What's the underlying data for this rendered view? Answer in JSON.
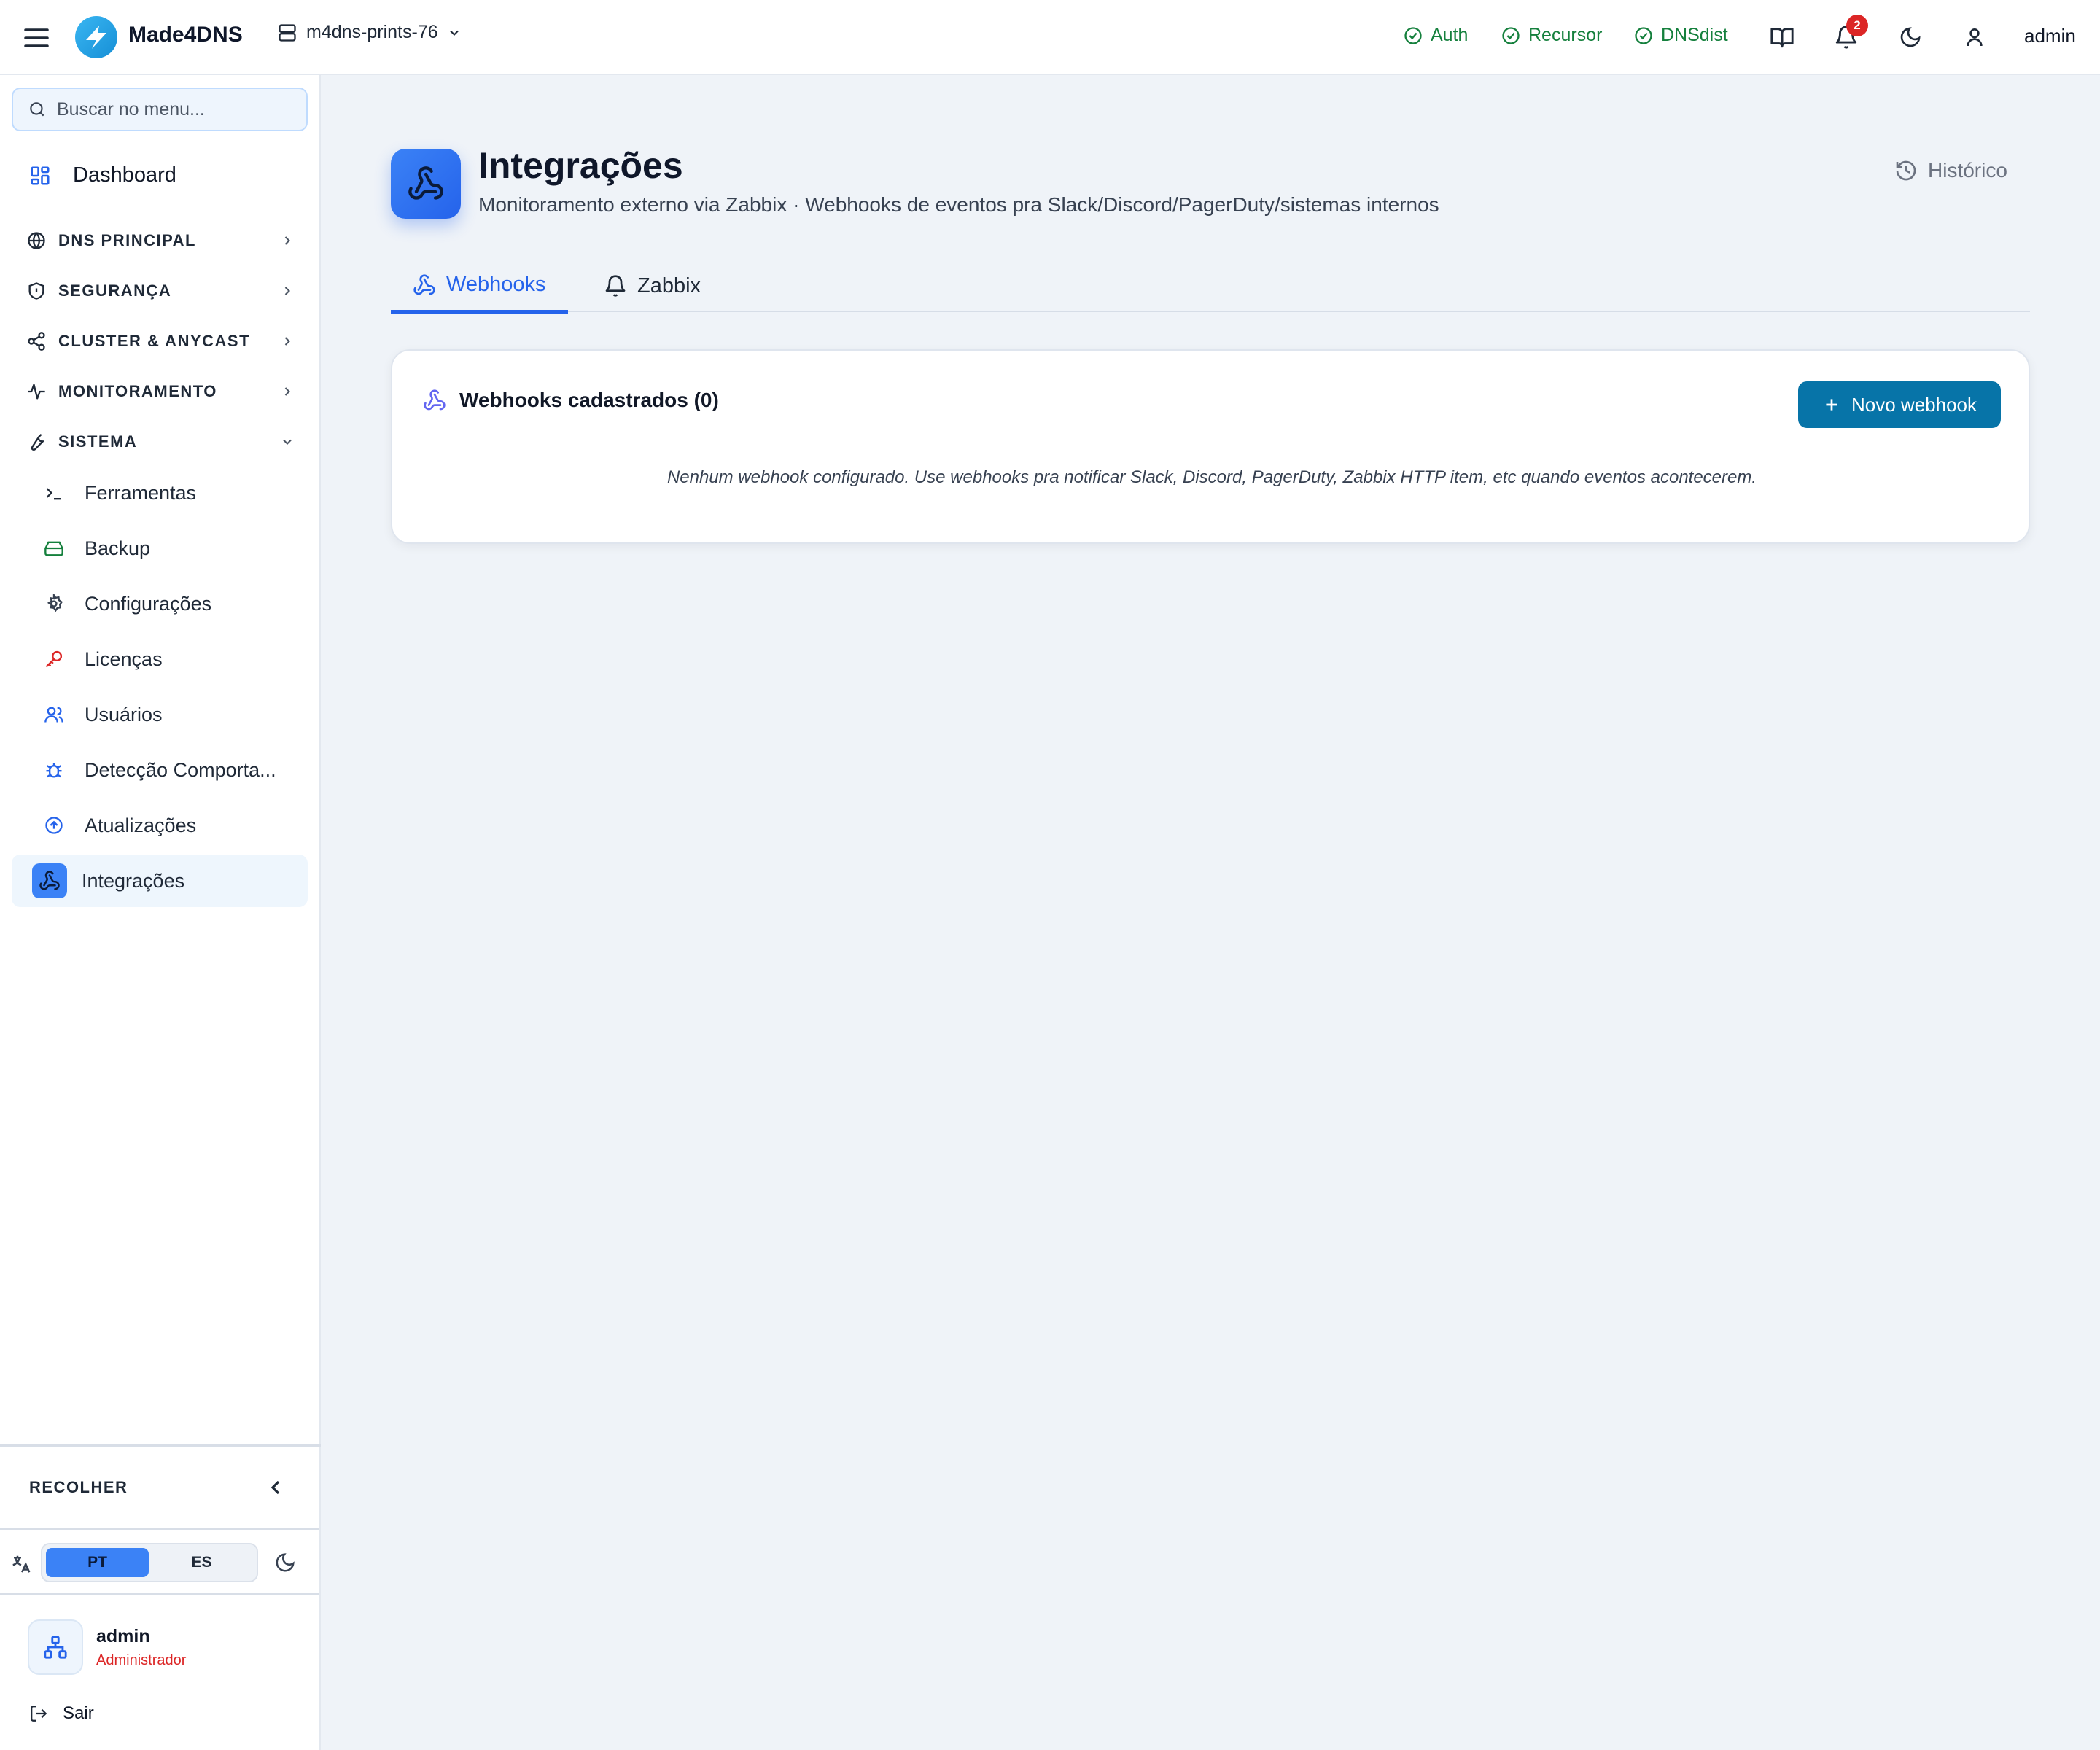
{
  "topbar": {
    "brand": "Made4DNS",
    "server": "m4dns-prints-76",
    "services": [
      {
        "label": "Auth",
        "status_color": "#15803d"
      },
      {
        "label": "Recursor",
        "status_color": "#15803d"
      },
      {
        "label": "DNSdist",
        "status_color": "#15803d"
      }
    ],
    "notification_count": "2",
    "user": "admin"
  },
  "sidebar": {
    "search_placeholder": "Buscar no menu...",
    "dashboard": "Dashboard",
    "sections": [
      {
        "label": "DNS PRINCIPAL",
        "icon": "globe-icon",
        "expanded": false
      },
      {
        "label": "SEGURANÇA",
        "icon": "shield-icon",
        "expanded": false
      },
      {
        "label": "CLUSTER & ANYCAST",
        "icon": "share-icon",
        "expanded": false
      },
      {
        "label": "MONITORAMENTO",
        "icon": "activity-icon",
        "expanded": false
      },
      {
        "label": "SISTEMA",
        "icon": "wrench-icon",
        "expanded": true
      }
    ],
    "system_items": [
      {
        "label": "Ferramentas",
        "icon": "terminal-icon"
      },
      {
        "label": "Backup",
        "icon": "hard-drive-icon"
      },
      {
        "label": "Configurações",
        "icon": "gear-icon"
      },
      {
        "label": "Licenças",
        "icon": "key-icon"
      },
      {
        "label": "Usuários",
        "icon": "users-icon"
      },
      {
        "label": "Detecção Comporta...",
        "icon": "bug-icon"
      },
      {
        "label": "Atualizações",
        "icon": "arrow-up-circle-icon"
      },
      {
        "label": "Integrações",
        "icon": "webhook-icon",
        "active": true
      }
    ],
    "collapse_label": "RECOLHER",
    "languages": [
      "PT",
      "ES"
    ],
    "selected_language": "PT",
    "user_name": "admin",
    "user_role": "Administrador",
    "logout": "Sair"
  },
  "page": {
    "title": "Integrações",
    "subtitle": "Monitoramento externo via Zabbix · Webhooks de eventos pra Slack/Discord/PagerDuty/sistemas internos",
    "history": "Histórico",
    "tabs": [
      {
        "label": "Webhooks",
        "active": true
      },
      {
        "label": "Zabbix",
        "active": false
      }
    ],
    "card": {
      "title": "Webhooks cadastrados (0)",
      "new_button": "Novo webhook",
      "empty_message": "Nenhum webhook configurado. Use webhooks pra notificar Slack, Discord, PagerDuty, Zabbix HTTP item, etc quando eventos acontecerem."
    }
  },
  "colors": {
    "accent": "#2563eb",
    "primary_button": "#0774a8",
    "status_ok": "#15803d",
    "danger": "#dc2626",
    "background": "#eff3f8"
  }
}
